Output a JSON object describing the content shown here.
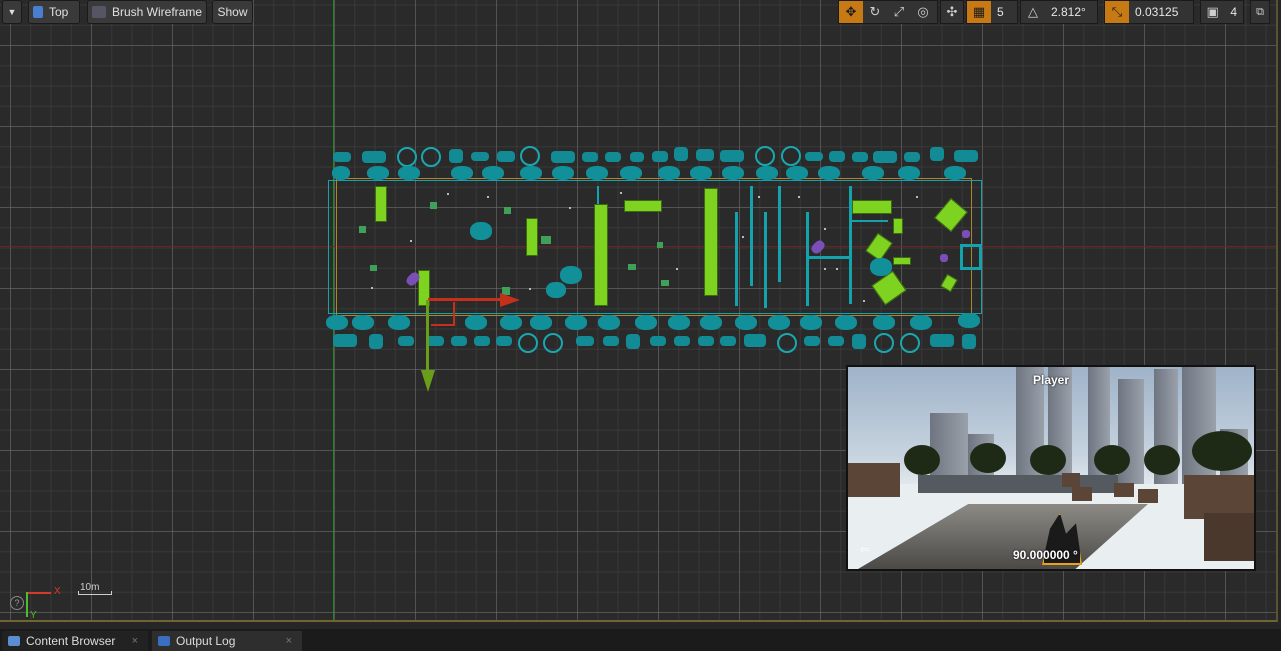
{
  "toolbar": {
    "view_mode": "Top",
    "render_mode": "Brush Wireframe",
    "show_label": "Show",
    "grid_snap_value": "5",
    "rotation_snap_value": "2.812°",
    "scale_snap_value": "0.03125",
    "camera_speed_value": "4"
  },
  "viewport": {
    "scale_label": "10m",
    "axis_x_label": "X",
    "axis_y_label": "Y",
    "help_glyph": "?"
  },
  "preview": {
    "title": "Player",
    "rotation_value": "90.000000 °"
  },
  "tabs": [
    {
      "label": "Content Browser",
      "close": "×"
    },
    {
      "label": "Output Log",
      "close": "×"
    }
  ],
  "colors": {
    "accent": "#c77a14",
    "mesh_cyan": "#138b95",
    "brush_green": "#7ed320",
    "x_axis": "#c4301a",
    "y_axis": "#6a9e1a"
  }
}
